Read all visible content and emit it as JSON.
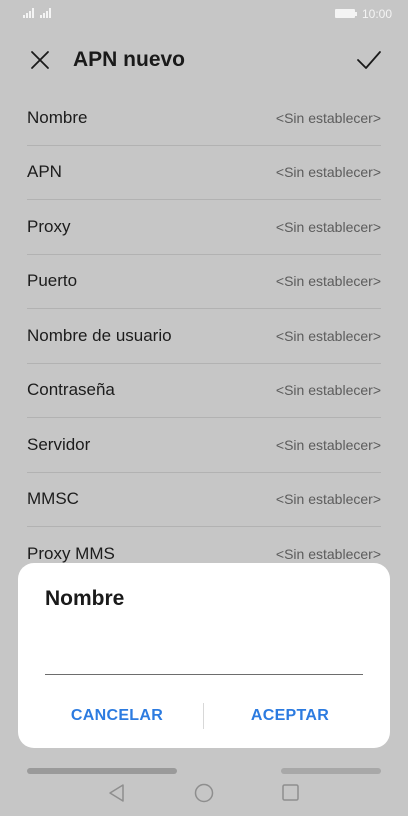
{
  "status_bar": {
    "time": "10:00",
    "battery_icon": "battery-icon",
    "signal_icon": "signal-icon"
  },
  "app_bar": {
    "title": "APN nuevo",
    "close_icon": "close-icon",
    "confirm_icon": "check-icon"
  },
  "settings": {
    "rows": [
      {
        "label": "Nombre",
        "value": "<Sin establecer>"
      },
      {
        "label": "APN",
        "value": "<Sin establecer>"
      },
      {
        "label": "Proxy",
        "value": "<Sin establecer>"
      },
      {
        "label": "Puerto",
        "value": "<Sin establecer>"
      },
      {
        "label": "Nombre de usuario",
        "value": "<Sin establecer>"
      },
      {
        "label": "Contraseña",
        "value": "<Sin establecer>"
      },
      {
        "label": "Servidor",
        "value": "<Sin establecer>"
      },
      {
        "label": "MMSC",
        "value": "<Sin establecer>"
      },
      {
        "label": "Proxy MMS",
        "value": "<Sin establecer>"
      }
    ]
  },
  "dialog": {
    "title": "Nombre",
    "input_value": "",
    "cancel_label": "CANCELAR",
    "accept_label": "ACEPTAR"
  },
  "nav_bar": {
    "back_icon": "back-triangle-icon",
    "home_icon": "home-circle-icon",
    "recents_icon": "recents-square-icon"
  },
  "colors": {
    "accent": "#2c7be0",
    "scrim_background": "#c6c6c6",
    "dialog_background": "#ffffff"
  }
}
